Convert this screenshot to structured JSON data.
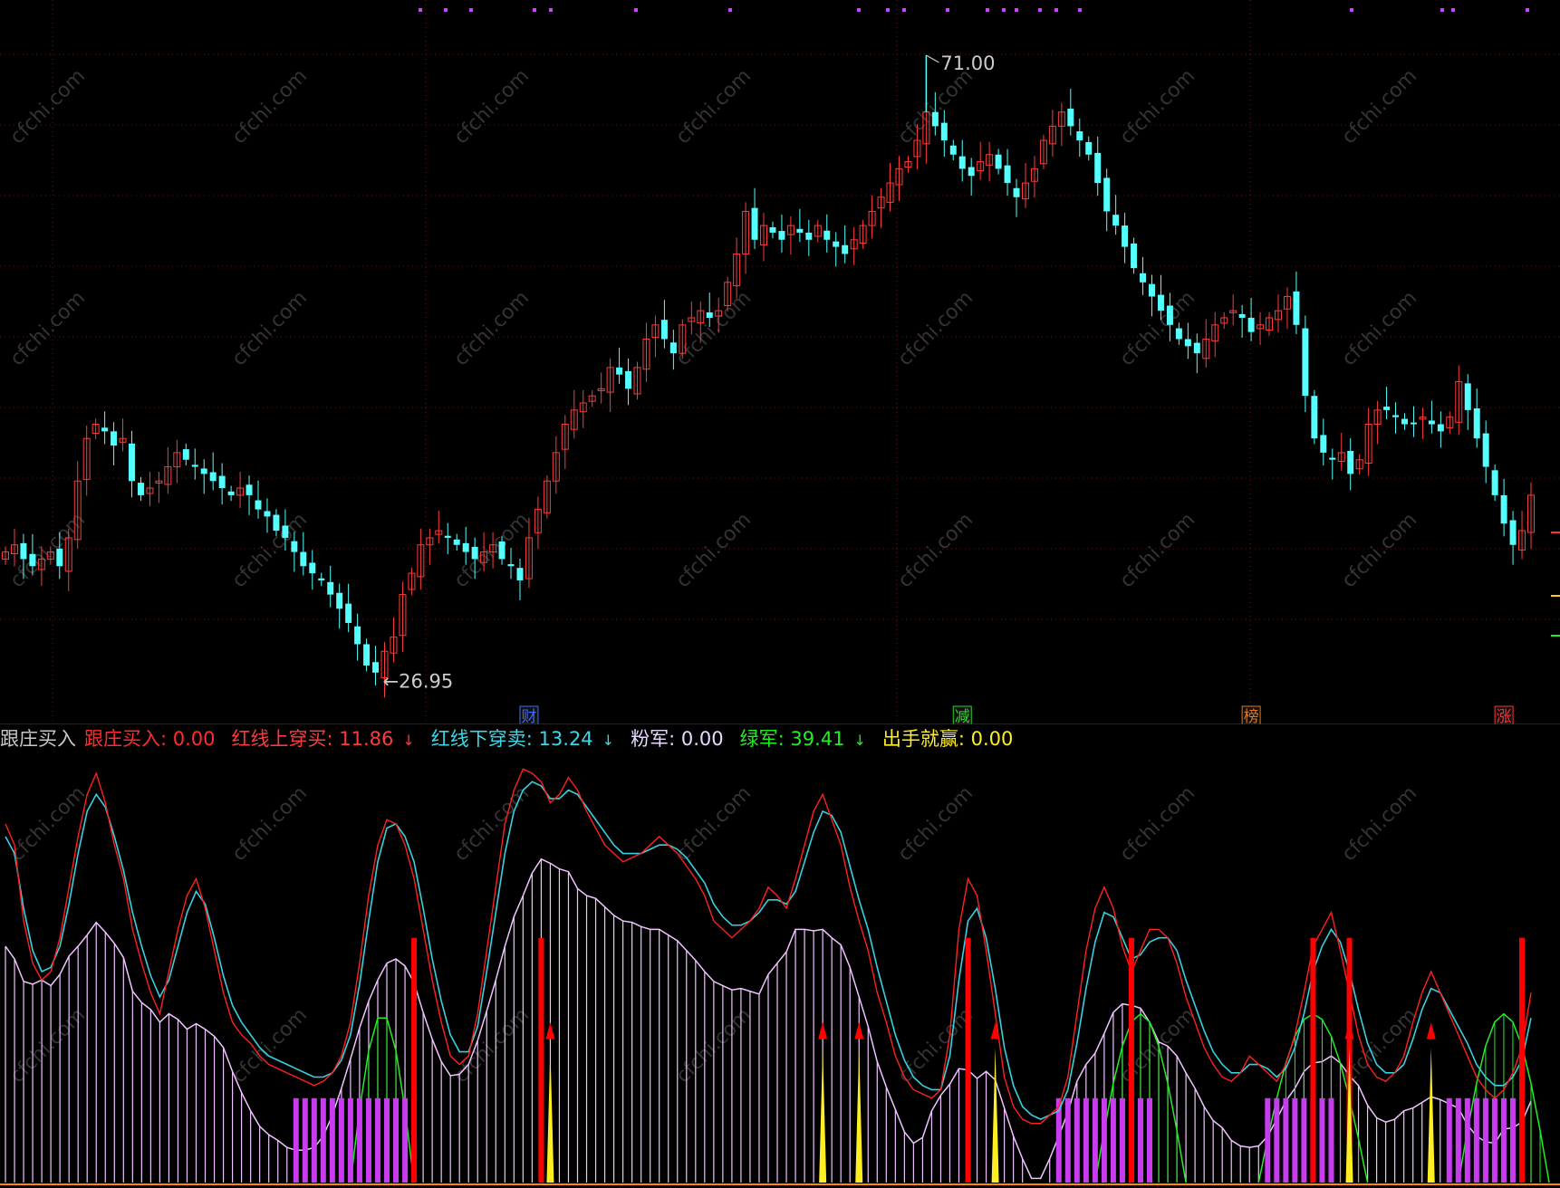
{
  "colors": {
    "up": "#ff3b3b",
    "down": "#54ffff",
    "red_line": "#ff2020",
    "cyan_line": "#39d0df",
    "pink": "#f0c4ff",
    "green": "#22ee22",
    "magenta": "#c83cf0",
    "yellow": "#ffee22",
    "signal_red": "#ff0000",
    "grid": "#7a1010",
    "marker_purple": "#d040ff",
    "legend_name": "#c8c8c8",
    "legend_buy": "#ff2d2d",
    "legend_redline": "#ff3a3a",
    "legend_cyan": "#3bd8e8",
    "legend_pink": "#e8d8ff",
    "legend_green": "#22ee22",
    "legend_yellow": "#ffee22",
    "watermark": "#333333"
  },
  "watermark": "cfchi.com",
  "price_panel": {
    "high_label": "71.00",
    "low_label": "26.95",
    "event_markers": [
      {
        "text": "财",
        "color": "#3c6cff",
        "index": 58
      },
      {
        "text": "减",
        "color": "#2ed12e",
        "index": 106
      },
      {
        "text": "榜",
        "color": "#e07820",
        "index": 138
      },
      {
        "text": "涨",
        "color": "#ff3030",
        "index": 166
      }
    ]
  },
  "indicator": {
    "name": "跟庄买入",
    "items": [
      {
        "label": "跟庄买入: 0.00",
        "color_key": "legend_buy",
        "arrow": ""
      },
      {
        "label": "红线上穿买: 11.86",
        "color_key": "legend_redline",
        "arrow": "↓"
      },
      {
        "label": "红线下穿卖: 13.24",
        "color_key": "legend_cyan",
        "arrow": "↓"
      },
      {
        "label": "粉军: 0.00",
        "color_key": "legend_pink",
        "arrow": ""
      },
      {
        "label": "绿军: 39.41",
        "color_key": "legend_green",
        "arrow": "↓"
      },
      {
        "label": "出手就赢: 0.00",
        "color_key": "legend_yellow",
        "arrow": ""
      }
    ]
  },
  "chart_data": [
    {
      "type": "candlestick",
      "title": "",
      "ylim": [
        25,
        74
      ],
      "high": 71.0,
      "low": 26.95,
      "closes": [
        36,
        36.5,
        35.5,
        35,
        35.5,
        36,
        35,
        37,
        41,
        44,
        45,
        44.5,
        43.5,
        44,
        41,
        40,
        40.5,
        41,
        42,
        43,
        42.5,
        42,
        41.5,
        41,
        40.5,
        40,
        40.5,
        40,
        39,
        38.5,
        37.5,
        37,
        36,
        35,
        34.5,
        34,
        33,
        32,
        31,
        29.5,
        28,
        27.5,
        29,
        30,
        33,
        34.5,
        36.5,
        37,
        37.5,
        37,
        36.5,
        36,
        35.5,
        36,
        36.5,
        35.5,
        35,
        34,
        37,
        39,
        41,
        43,
        45,
        46,
        46.5,
        47,
        47.5,
        49,
        48.5,
        47.5,
        49,
        51,
        52,
        51,
        50,
        52,
        52.5,
        53,
        52.5,
        53,
        55,
        57,
        60,
        58,
        59,
        58.5,
        58,
        59,
        58.5,
        58,
        59,
        58,
        57.5,
        57,
        58,
        59,
        60,
        61,
        62,
        63,
        63.5,
        65,
        67,
        66,
        65,
        64,
        63,
        62.5,
        63.5,
        64,
        63,
        62,
        61,
        62,
        63,
        65,
        66,
        67,
        66,
        65,
        64,
        62,
        60,
        59,
        57.5,
        56,
        55,
        54,
        53,
        52,
        51,
        50.5,
        50,
        51,
        52,
        52.5,
        53,
        52.5,
        51.5,
        52,
        52.5,
        53,
        54,
        52,
        47,
        44,
        43,
        42.5,
        43,
        41.5,
        42.5,
        45,
        46,
        46,
        45.5,
        45,
        45,
        45.5,
        45,
        44.5,
        45.5,
        48,
        46,
        44,
        42,
        40,
        38,
        36.5,
        37.5,
        40
      ]
    },
    {
      "type": "line",
      "title": "",
      "ylim": [
        0,
        100
      ],
      "series": [
        {
          "name": "跟庄买入",
          "values": [
            0,
            0,
            0,
            0,
            0,
            0,
            0,
            0,
            0,
            0,
            0,
            0,
            0,
            0,
            0,
            0,
            0,
            0,
            0,
            0,
            0,
            0,
            0,
            0,
            0,
            0,
            0,
            0,
            0,
            0,
            0,
            0,
            0,
            0,
            0,
            0,
            0,
            0,
            0,
            0,
            0,
            0,
            0,
            0,
            0,
            0,
            0,
            0,
            0,
            0,
            0,
            0,
            0,
            0,
            0,
            0,
            0,
            0,
            0,
            0,
            0,
            0,
            0,
            0,
            0,
            0,
            0,
            0,
            0,
            0,
            0,
            0,
            0,
            0,
            0,
            0,
            0,
            0,
            0,
            0,
            0,
            0,
            0,
            0,
            0,
            0,
            0,
            0,
            0,
            0,
            0,
            0,
            0,
            0,
            0,
            0,
            0,
            0,
            0,
            0,
            0,
            0,
            0,
            0,
            0,
            0,
            0,
            0,
            0,
            0,
            0,
            0,
            0,
            0,
            0,
            0,
            0,
            0,
            0,
            0,
            0,
            0,
            0,
            0,
            0,
            0,
            0,
            0,
            0,
            0,
            0,
            0,
            0,
            0,
            0,
            0,
            0,
            0,
            0,
            0,
            0,
            0,
            0,
            0,
            0,
            0,
            0,
            0,
            0,
            0,
            0,
            0,
            0,
            0,
            0,
            0,
            0,
            0,
            0,
            0,
            0,
            0,
            0,
            0,
            0,
            0,
            0,
            0,
            0,
            0,
            0,
            0,
            0
          ]
        },
        {
          "name": "红线上穿买",
          "values": [
            85,
            80,
            62,
            52,
            48,
            50,
            58,
            70,
            82,
            92,
            97,
            90,
            80,
            72,
            60,
            52,
            45,
            40,
            50,
            60,
            68,
            72,
            65,
            55,
            45,
            38,
            35,
            33,
            30,
            28,
            27,
            26,
            25,
            24,
            23,
            24,
            26,
            30,
            38,
            52,
            68,
            80,
            86,
            85,
            80,
            72,
            60,
            48,
            38,
            30,
            28,
            30,
            40,
            55,
            70,
            85,
            93,
            98,
            97,
            95,
            90,
            92,
            96,
            93,
            88,
            84,
            80,
            78,
            76,
            77,
            78,
            80,
            82,
            80,
            78,
            75,
            72,
            68,
            62,
            60,
            58,
            60,
            62,
            65,
            70,
            68,
            65,
            72,
            80,
            88,
            92,
            86,
            80,
            70,
            62,
            55,
            45,
            38,
            30,
            25,
            22,
            21,
            20,
            22,
            35,
            60,
            72,
            68,
            55,
            40,
            25,
            18,
            15,
            14,
            14,
            16,
            18,
            25,
            40,
            55,
            65,
            70,
            65,
            56,
            50,
            55,
            60,
            60,
            58,
            52,
            44,
            38,
            32,
            28,
            25,
            24,
            26,
            30,
            28,
            26,
            24,
            28,
            35,
            45,
            56,
            60,
            64,
            55,
            45,
            35,
            28,
            25,
            24,
            26,
            30,
            38,
            45,
            50,
            45,
            40,
            35,
            30,
            25,
            22,
            20,
            22,
            26,
            32,
            45
          ]
        },
        {
          "name": "红线下穿卖",
          "values": [
            82,
            78,
            65,
            55,
            50,
            51,
            56,
            66,
            78,
            88,
            92,
            89,
            82,
            74,
            64,
            56,
            49,
            44,
            48,
            56,
            64,
            69,
            66,
            58,
            49,
            42,
            38,
            35,
            32,
            30,
            29,
            28,
            27,
            26,
            25,
            25,
            26,
            29,
            35,
            47,
            62,
            76,
            84,
            85,
            82,
            76,
            65,
            53,
            43,
            35,
            31,
            31,
            37,
            50,
            64,
            78,
            88,
            93,
            95,
            94,
            91,
            91,
            93,
            92,
            89,
            86,
            83,
            80,
            78,
            78,
            78,
            79,
            80,
            80,
            79,
            77,
            74,
            71,
            66,
            63,
            61,
            61,
            62,
            64,
            67,
            67,
            66,
            69,
            76,
            83,
            88,
            87,
            83,
            75,
            67,
            60,
            51,
            43,
            35,
            29,
            25,
            23,
            22,
            22,
            30,
            48,
            62,
            65,
            58,
            46,
            32,
            23,
            18,
            16,
            15,
            16,
            17,
            22,
            33,
            46,
            57,
            64,
            63,
            58,
            53,
            54,
            57,
            58,
            58,
            55,
            48,
            42,
            36,
            31,
            28,
            26,
            26,
            28,
            28,
            27,
            25,
            27,
            32,
            40,
            50,
            56,
            60,
            57,
            50,
            41,
            33,
            28,
            26,
            26,
            28,
            34,
            41,
            46,
            45,
            41,
            37,
            33,
            28,
            25,
            23,
            23,
            25,
            29,
            39
          ]
        }
      ]
    }
  ]
}
